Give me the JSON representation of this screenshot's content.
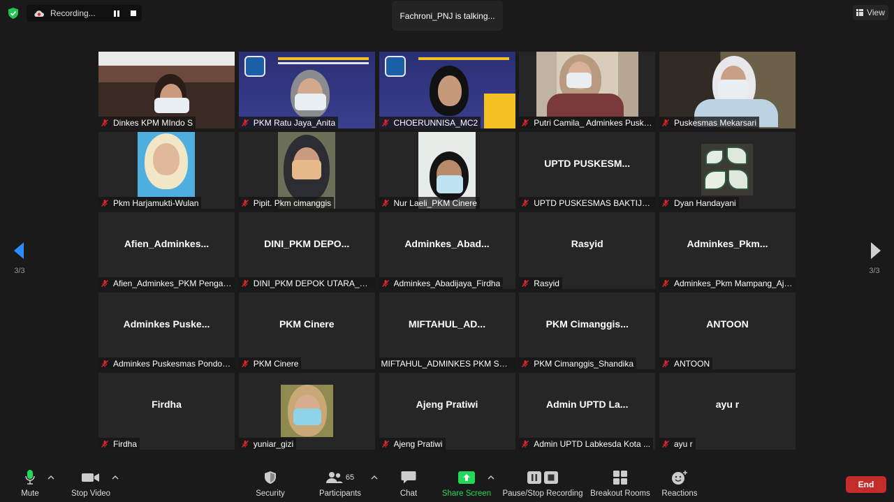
{
  "top": {
    "recording_label": "Recording...",
    "talking_label": "Fachroni_PNJ is talking...",
    "view_label": "View"
  },
  "paging": {
    "left_label": "3/3",
    "right_label": "3/3"
  },
  "tiles": [
    {
      "name": "Dinkes KPM MIndo S",
      "display": "",
      "video": true
    },
    {
      "name": "PKM Ratu Jaya_Anita",
      "display": "",
      "video": true
    },
    {
      "name": "CHOERUNNISA_MC2",
      "display": "",
      "video": true
    },
    {
      "name": "Putri Camila_ Adminkes Puske...",
      "display": "",
      "video": true
    },
    {
      "name": "Puskesmas Mekarsari",
      "display": "",
      "video": true
    },
    {
      "name": "Pkm Harjamukti-Wulan",
      "display": "",
      "video": true
    },
    {
      "name": "Pipit. Pkm cimanggis",
      "display": "",
      "video": true
    },
    {
      "name": "Nur Laeli_PKM Cinere",
      "display": "",
      "video": true
    },
    {
      "name": "UPTD PUSKESMAS BAKTIJAYA",
      "display": "UPTD  PUSKESM...",
      "video": false
    },
    {
      "name": "Dyan Handayani",
      "display": "",
      "video": true
    },
    {
      "name": "Afien_Adminkes_PKM Pengasi...",
      "display": "Afien_Adminkes...",
      "video": false
    },
    {
      "name": "DINI_PKM DEPOK UTARA_AD...",
      "display": "DINI_PKM  DEPO...",
      "video": false
    },
    {
      "name": "Adminkes_Abadijaya_Firdha",
      "display": "Adminkes_Abad...",
      "video": false
    },
    {
      "name": "Rasyid",
      "display": "Rasyid",
      "video": false
    },
    {
      "name": "Adminkes_Pkm Mampang_Aje...",
      "display": "Adminkes_Pkm...",
      "video": false
    },
    {
      "name": "Adminkes Puskesmas Pondok...",
      "display": "Adminkes  Puske...",
      "video": false
    },
    {
      "name": "PKM Cinere",
      "display": "PKM Cinere",
      "video": false
    },
    {
      "name": "MIFTAHUL_ADMINKES PKM SAW...",
      "display": "MIFTAHUL_AD...",
      "video": false,
      "no_mic_icon": true
    },
    {
      "name": "PKM Cimanggis_Shandika",
      "display": "PKM  Cimanggis...",
      "video": false
    },
    {
      "name": "ANTOON",
      "display": "ANTOON",
      "video": false
    },
    {
      "name": "Firdha",
      "display": "Firdha",
      "video": false
    },
    {
      "name": "yuniar_gizi",
      "display": "",
      "video": true
    },
    {
      "name": "Ajeng Pratiwi",
      "display": "Ajeng Pratiwi",
      "video": false
    },
    {
      "name": "Admin UPTD Labkesda Kota ...",
      "display": "Admin  UPTD  La...",
      "video": false
    },
    {
      "name": "ayu r",
      "display": "ayu r",
      "video": false
    }
  ],
  "toolbar": {
    "mute": "Mute",
    "stop_video": "Stop Video",
    "security": "Security",
    "participants": "Participants",
    "participants_count": "65",
    "chat": "Chat",
    "share_screen": "Share Screen",
    "pause_recording": "Pause/Stop Recording",
    "breakout_rooms": "Breakout Rooms",
    "reactions": "Reactions",
    "end": "End"
  },
  "colors": {
    "share_green": "#23d959",
    "end_red": "#c42b2b",
    "muted_red": "#e0262b",
    "shield_green": "#23c552"
  }
}
